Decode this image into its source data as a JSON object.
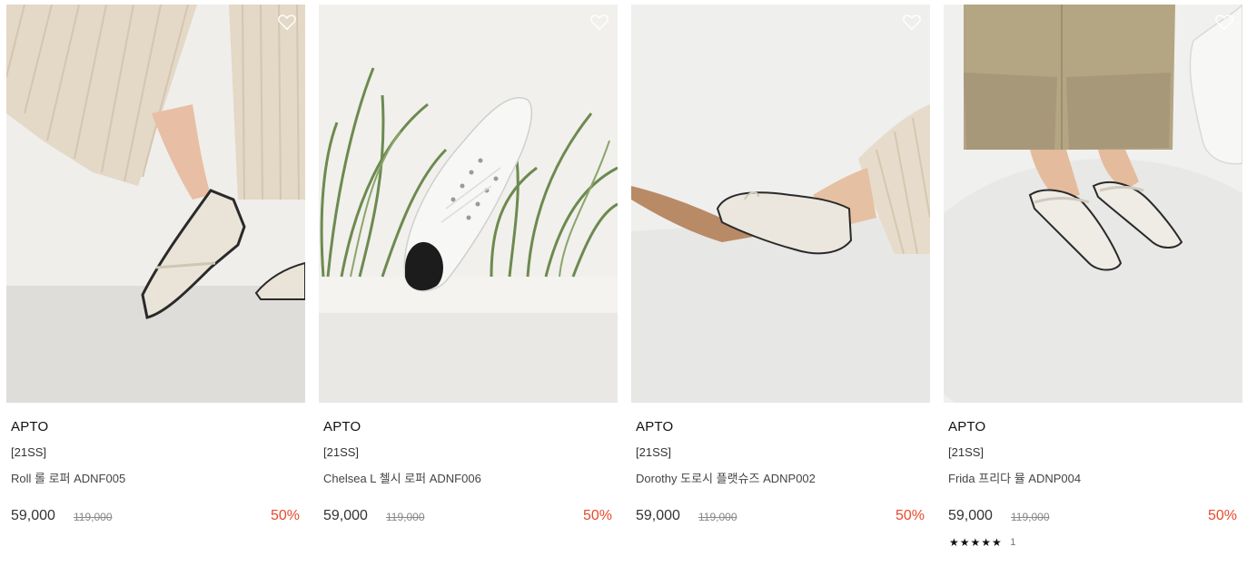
{
  "products": [
    {
      "brand": "APTO",
      "season": "[21SS]",
      "name": "Roll 롤 로퍼 ADNF005",
      "price": "59,000",
      "original_price": "119,000",
      "discount": "50%",
      "wishlist_icon": "heart-outline-icon"
    },
    {
      "brand": "APTO",
      "season": "[21SS]",
      "name": "Chelsea L 첼시 로퍼 ADNF006",
      "price": "59,000",
      "original_price": "119,000",
      "discount": "50%",
      "wishlist_icon": "heart-outline-icon"
    },
    {
      "brand": "APTO",
      "season": "[21SS]",
      "name": "Dorothy 도로시 플랫슈즈 ADNP002",
      "price": "59,000",
      "original_price": "119,000",
      "discount": "50%",
      "wishlist_icon": "heart-outline-icon"
    },
    {
      "brand": "APTO",
      "season": "[21SS]",
      "name": "Frida 프리다 뮬 ADNP004",
      "price": "59,000",
      "original_price": "119,000",
      "discount": "50%",
      "wishlist_icon": "heart-outline-icon",
      "rating": {
        "stars": "★★★★★",
        "count": "1"
      }
    }
  ],
  "colors": {
    "discount": "#e8492a",
    "text": "#222222",
    "muted": "#888888"
  }
}
